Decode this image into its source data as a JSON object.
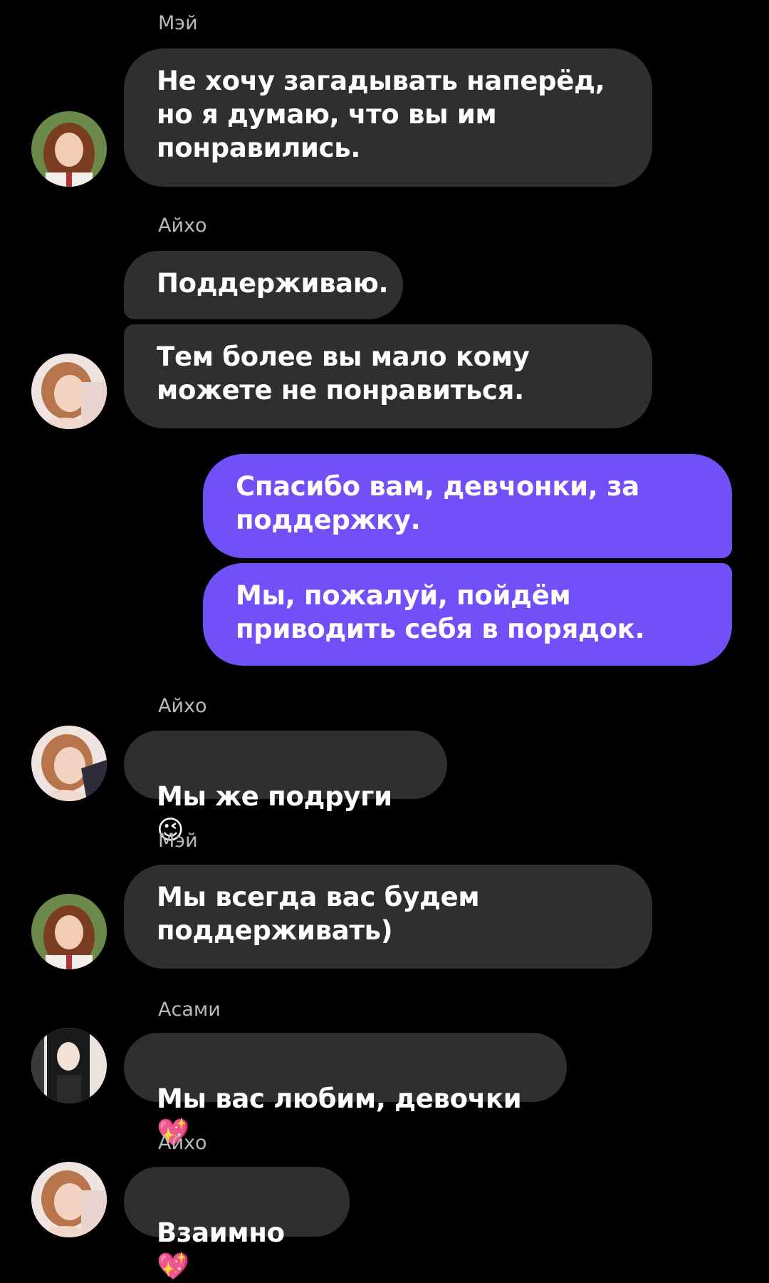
{
  "colors": {
    "background": "#000000",
    "incoming_bubble": "#2f2f31",
    "outgoing_bubble": "#7150f7",
    "sender_name": "#b9b9b9",
    "text": "#ffffff"
  },
  "messages": [
    {
      "sender": "Мэй",
      "avatar": "mei-avatar",
      "text": "Не хочу загадывать наперёд,\nно я думаю, что вы им\nпонравились."
    },
    {
      "sender": "Айхо",
      "text": "Поддерживаю."
    },
    {
      "avatar": "aiho-avatar",
      "text": "Тем более вы мало кому\nможете не понравиться."
    },
    {
      "outgoing": true,
      "text": "Спасибо вам, девчонки, за\nподдержку."
    },
    {
      "outgoing": true,
      "text": "Мы, пожалуй, пойдём\nприводить себя в порядок."
    },
    {
      "sender": "Айхо",
      "avatar": "aiho-avatar",
      "text": "Мы же подруги",
      "emoji": "😉"
    },
    {
      "sender": "Мэй",
      "avatar": "mei-avatar",
      "text": "Мы всегда вас будем\nподдерживать)"
    },
    {
      "sender": "Асами",
      "avatar": "asami-avatar",
      "text": "Мы вас любим, девочки",
      "emoji": "💖"
    },
    {
      "sender": "Айхо",
      "avatar": "aiho-avatar",
      "text": "Взаимно",
      "emoji": "💖"
    }
  ]
}
